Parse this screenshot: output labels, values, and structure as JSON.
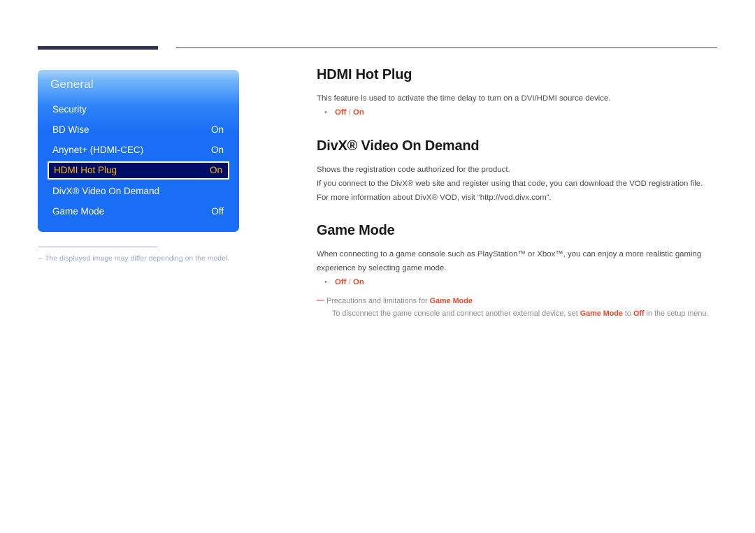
{
  "page": {
    "top_rule": "decorative-rule"
  },
  "osd": {
    "title": "General",
    "rows": [
      {
        "label": "Security",
        "value": "",
        "selected": false
      },
      {
        "label": "BD Wise",
        "value": "On",
        "selected": false
      },
      {
        "label": "Anynet+ (HDMI-CEC)",
        "value": "On",
        "selected": false
      },
      {
        "label": "HDMI Hot Plug",
        "value": "On",
        "selected": true
      },
      {
        "label": "DivX® Video On Demand",
        "value": "",
        "selected": false
      },
      {
        "label": "Game Mode",
        "value": "Off",
        "selected": false
      }
    ]
  },
  "figure_note": {
    "dash": "–",
    "text": "The displayed image may differ depending on the model."
  },
  "sections": {
    "hdmi_hot_plug": {
      "heading": "HDMI Hot Plug",
      "paragraph": "This feature is used to activate the time delay to turn on a DVI/HDMI source device.",
      "bullet": {
        "dot": "•",
        "option_a": "Off",
        "separator": " / ",
        "option_b": "On"
      }
    },
    "divx_vod": {
      "heading": "DivX® Video On Demand",
      "paragraph_1": "Shows the registration code authorized for the product.",
      "paragraph_2": "If you connect to the DivX® web site and register using that code, you can download the VOD registration file.",
      "paragraph_3": "For more information about DivX® VOD, visit “http://vod.divx.com”."
    },
    "game_mode": {
      "heading": "Game Mode",
      "paragraph": "When connecting to a game console such as PlayStation™ or Xbox™, you can enjoy a more realistic gaming experience by selecting game mode.",
      "bullet": {
        "dot": "•",
        "option_a": "Off",
        "separator": " / ",
        "option_b": "On"
      },
      "precautions": {
        "dash": "—",
        "head_prefix": "Precautions and limitations for ",
        "head_term": "Game Mode",
        "body_part_1": "To disconnect the game console and connect another external device, set ",
        "body_term_1": "Game Mode",
        "body_part_2": " to ",
        "body_term_2": "Off",
        "body_part_3": " in the setup menu."
      }
    }
  },
  "colors": {
    "accent_red": "#e8482a",
    "osd_blue": "#1a6ef6",
    "osd_selected_bg": "#000d66",
    "osd_selected_text": "#ffb300",
    "rule_navy": "#2e3253",
    "note_gray": "#9fa8c6"
  }
}
